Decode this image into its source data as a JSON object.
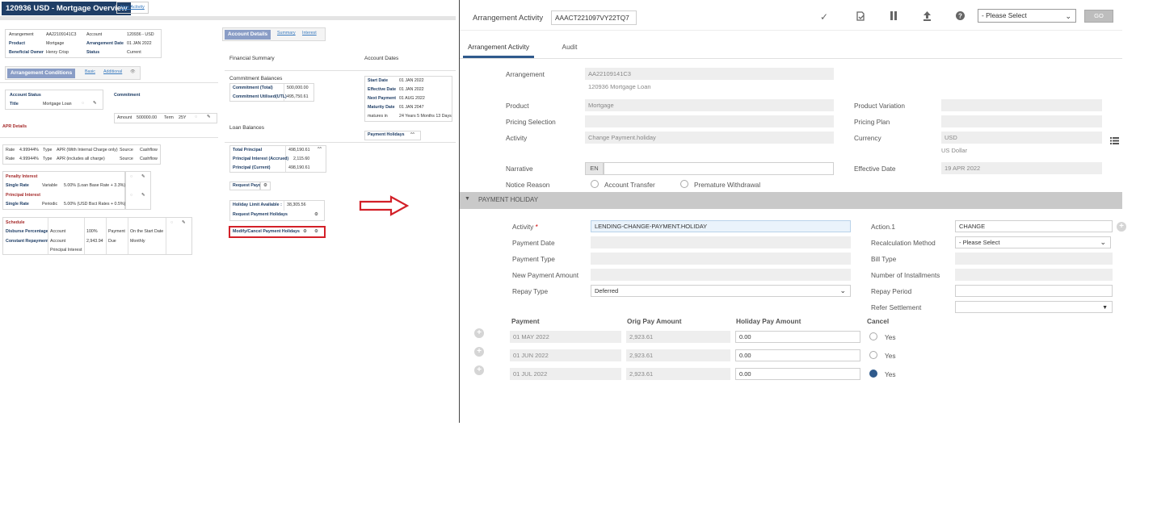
{
  "overview": {
    "title": "120936 USD - Mortgage Overview",
    "new_activity": "New Activity",
    "arrangement": {
      "l1": "Arrangement",
      "v1": "AA22109141C3",
      "l2": "Account",
      "v2": "120936 - USD",
      "l3": "Product",
      "v3": "Mortgage",
      "l4": "Arrangement Date",
      "v4": "01 JAN 2022",
      "l5": "Beneficial Owner",
      "v5": "Henry Crisp",
      "l6": "Status",
      "v6": "Current"
    },
    "conditions": {
      "label": "Arrangement Conditions",
      "basic": "Basic",
      "additional": "Additional",
      "eye": "👁"
    },
    "account_status": {
      "label": "Account Status",
      "title_label": "Title",
      "title_value": "Mortgage Loan",
      "commitment": "Commitment"
    },
    "amount_row": {
      "amount_label": "Amount",
      "amount": "500000.00",
      "term_label": "Term",
      "term": "25Y"
    },
    "apr_details": "APR Details",
    "rates": [
      {
        "c1": "Rate",
        "c2": "4.99944%",
        "c3": "Type",
        "c4": "APR (With Internal Charge only)",
        "c5": "Source",
        "c6": "Cashflow"
      },
      {
        "c1": "Rate",
        "c2": "4.99944%",
        "c3": "Type",
        "c4": "APR (includes all charge)",
        "c5": "Source",
        "c6": "Cashflow"
      }
    ],
    "interest": {
      "penalty": "Penalty Interest",
      "single1": "Single Rate",
      "variable": "Variable",
      "v1": "5.00% (Loan Base Rate + 3.3%)",
      "principal": "Principal Interest",
      "single2": "Single Rate",
      "periodic": "Periodic",
      "v2": "5.00% (USD Bsct Rates + 0.5%)"
    },
    "schedule": {
      "label": "Schedule",
      "disburse": "Disburse Percentage",
      "constant": "Constant Repayment",
      "acc1": "Account",
      "acc2": "Account",
      "pint": "Principal Interest",
      "pct": "100%",
      "amt": "2,943.94",
      "pay": "Payment",
      "due": "Due",
      "start": "On the Start Date",
      "monthly": "Monthly"
    },
    "account_details": {
      "label": "Account Details",
      "summary": "Summary",
      "interest": "Interest"
    },
    "financial_summary": "Financial Summary",
    "account_dates": "Account Dates",
    "commitment_balances": "Commitment Balances",
    "commit": {
      "l1": "Commitment (Total)",
      "v1": "500,000.00",
      "l2": "Commitment Utilised(UTL)",
      "v2": "495,750.61"
    },
    "dates": [
      {
        "k": "Start Date",
        "v": "01 JAN 2022"
      },
      {
        "k": "Effective Date",
        "v": "01 JAN 2022"
      },
      {
        "k": "Next Payment",
        "v": "01 AUG 2022"
      },
      {
        "k": "Maturity Date",
        "v": "01 JAN 2047"
      },
      {
        "k": "matures in",
        "v": "24 Years 5 Months 13 Days"
      }
    ],
    "payment_holidays": "Payment Holidays",
    "loan_balances": "Loan Balances",
    "loan": {
      "l1": "Total Principal",
      "v1": "498,190.61",
      "l2": "Principal Interest (Accrued)",
      "v2": "2,115.60",
      "l3": "Principal (Current)",
      "v3": "498,190.61"
    },
    "request_payoff": "Request Payoff",
    "holiday_limit": "Holiday Limit Available :",
    "holiday_limit_value": "38,305.56",
    "request_payment_holidays": "Request Payment Holidays",
    "modify_cancel": "Modify/Cancel Payment Holidays"
  },
  "activity": {
    "title_label": "Arrangement Activity",
    "id": "AAACT221097VY22TQ7",
    "select_placeholder": "- Please Select",
    "go": "GO",
    "tabs": [
      "Arrangement Activity",
      "Audit"
    ],
    "arrangement_label": "Arrangement",
    "arrangement_value": "AA22109141C3",
    "arrangement_sub": "120936 Mortgage Loan",
    "product_label": "Product",
    "product_value": "Mortgage",
    "product_variation_label": "Product Variation",
    "pricing_selection_label": "Pricing Selection",
    "pricing_plan_label": "Pricing Plan",
    "activity_label": "Activity",
    "activity_value": "Change Payment.holiday",
    "currency_label": "Currency",
    "currency_value": "USD",
    "currency_sub": "US Dollar",
    "narrative_label": "Narrative",
    "narrative_lang": "EN",
    "effective_date_label": "Effective Date",
    "effective_date_value": "19 APR 2022",
    "notice_reason_label": "Notice Reason",
    "notice_opt1": "Account Transfer",
    "notice_opt2": "Premature Withdrawal",
    "section": "PAYMENT HOLIDAY",
    "ph": {
      "activity_label": "Activity",
      "required": "*",
      "activity_value": "LENDING-CHANGE-PAYMENT.HOLIDAY",
      "action_label": "Action.1",
      "action_value": "CHANGE",
      "payment_date_label": "Payment Date",
      "recalc_label": "Recalculation Method",
      "recalc_value": "- Please Select",
      "payment_type_label": "Payment Type",
      "bill_type_label": "Bill Type",
      "new_payment_label": "New Payment Amount",
      "num_install_label": "Number of Installments",
      "repay_type_label": "Repay Type",
      "repay_type_value": "Deferred",
      "repay_period_label": "Repay Period",
      "refer_settlement_label": "Refer Settlement"
    },
    "table": {
      "headers": [
        "Payment",
        "Orig Pay Amount",
        "Holiday Pay Amount",
        "Cancel"
      ],
      "rows": [
        {
          "payment": "01 MAY 2022",
          "orig": "2,923.61",
          "holiday": "0.00",
          "cancel": "Yes",
          "checked": false
        },
        {
          "payment": "01 JUN 2022",
          "orig": "2,923.61",
          "holiday": "0.00",
          "cancel": "Yes",
          "checked": false
        },
        {
          "payment": "01 JUL 2022",
          "orig": "2,923.61",
          "holiday": "0.00",
          "cancel": "Yes",
          "checked": true
        }
      ]
    }
  }
}
